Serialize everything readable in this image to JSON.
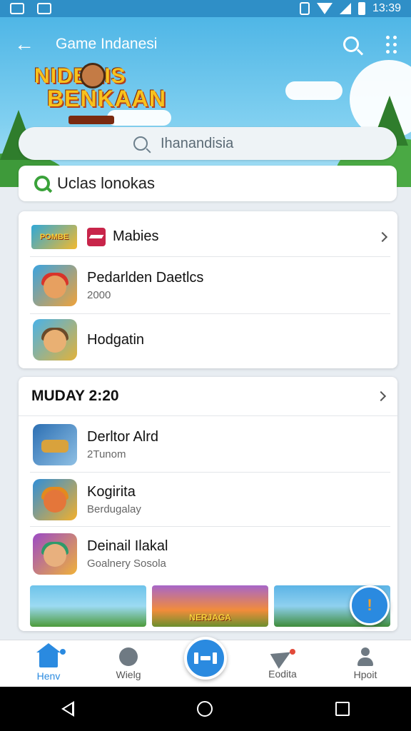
{
  "status_bar": {
    "time": "13:39"
  },
  "header": {
    "title": "Game Indanesi",
    "logo_line1": "NIDBEIS",
    "logo_line2": "BENKAAN"
  },
  "search": {
    "value": "Ihanandisia"
  },
  "filter": {
    "label": "Uclas lonokas"
  },
  "card1": {
    "header_label": "Mabies",
    "items": [
      {
        "title": "Pedarlden Daetlcs",
        "subtitle": "2000"
      },
      {
        "title": "Hodgatin",
        "subtitle": ""
      }
    ]
  },
  "card2": {
    "section_title": "MUDAY 2:20",
    "items": [
      {
        "title": "Derltor Alrd",
        "subtitle": "2Tunom"
      },
      {
        "title": "Kogirita",
        "subtitle": "Berdugalay"
      },
      {
        "title": "Deinail Ilakal",
        "subtitle": "Goalnery Sosola"
      }
    ]
  },
  "bottom_nav": {
    "items": [
      {
        "label": "Henv",
        "icon": "home-icon",
        "active": true
      },
      {
        "label": "Wielg",
        "icon": "profile-icon",
        "active": false
      },
      {
        "label": "Eodita",
        "icon": "send-icon",
        "active": false
      },
      {
        "label": "Hpoit",
        "icon": "person-icon",
        "active": false
      }
    ]
  },
  "colors": {
    "accent": "#2a8ae0",
    "header_sky": "#4fb6e6",
    "filter_icon": "#3aa23a"
  }
}
